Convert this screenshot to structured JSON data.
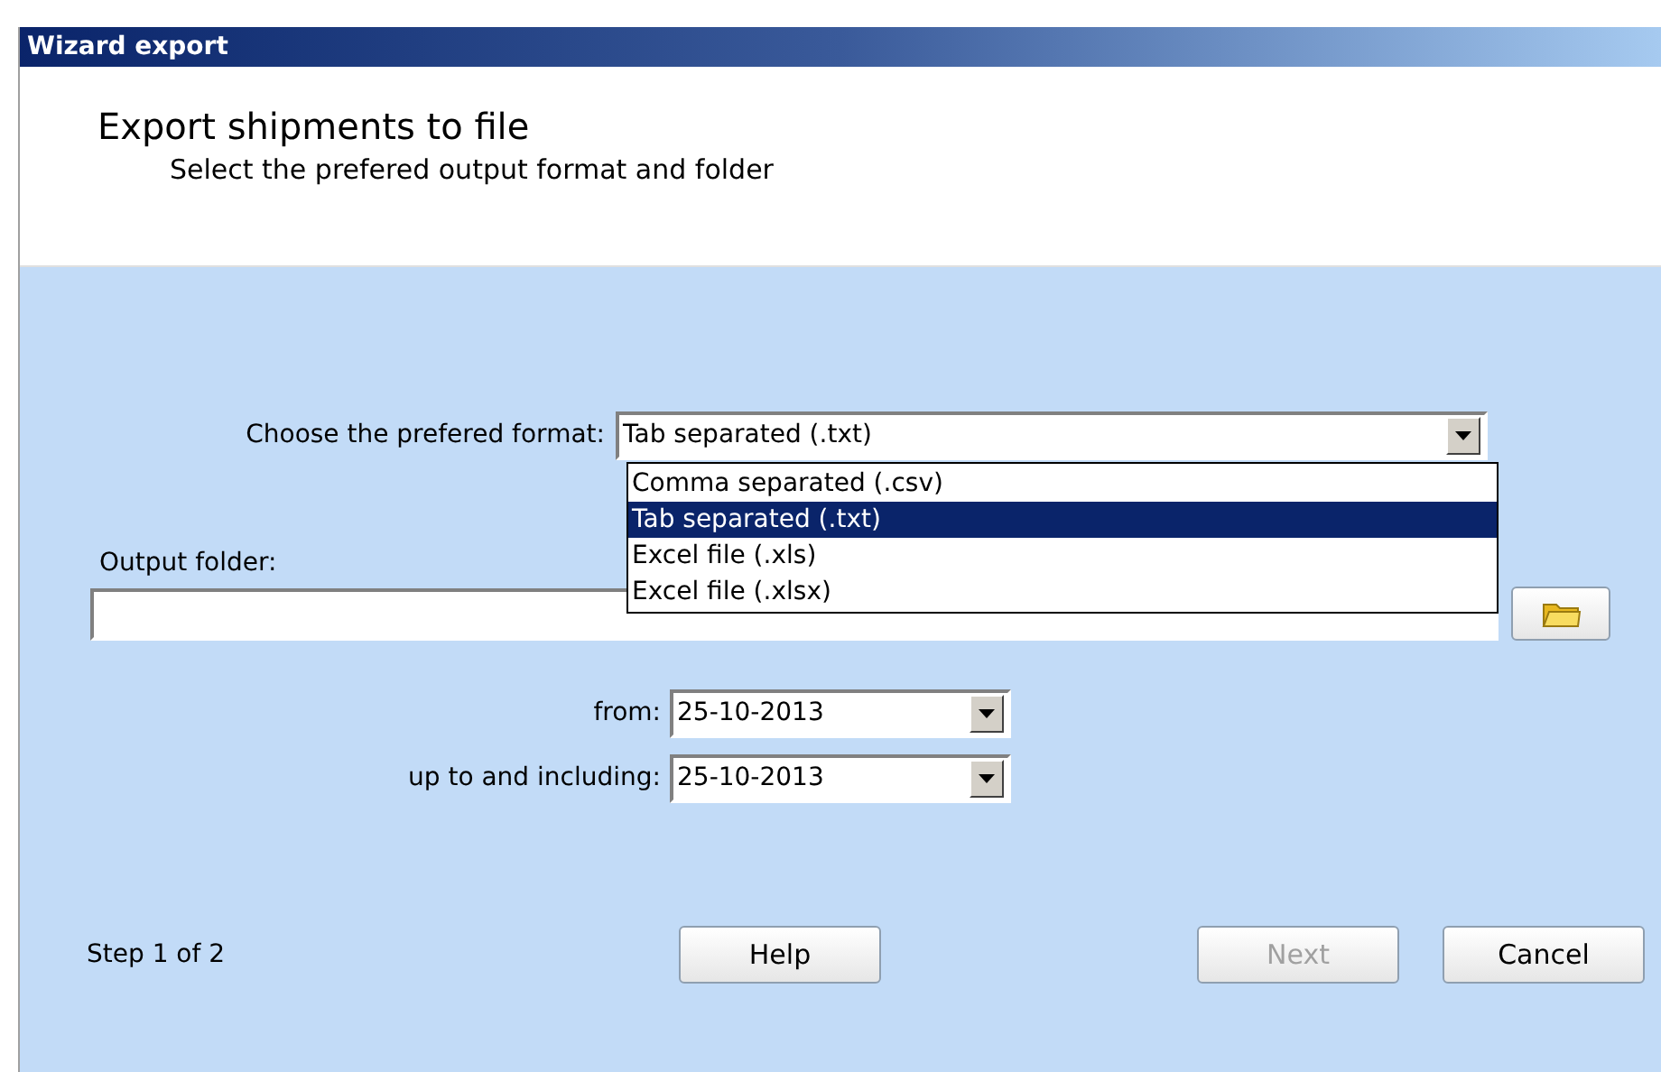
{
  "window": {
    "title": "Wizard export"
  },
  "header": {
    "title": "Export shipments to file",
    "subtitle": "Select the prefered output format and folder"
  },
  "format": {
    "label": "Choose the prefered format:",
    "value": "Tab separated (.txt)",
    "expanded": true,
    "options": [
      {
        "label": "Comma separated (.csv)",
        "selected": false
      },
      {
        "label": "Tab separated (.txt)",
        "selected": true
      },
      {
        "label": "Excel file (.xls)",
        "selected": false
      },
      {
        "label": "Excel file (.xlsx)",
        "selected": false
      }
    ]
  },
  "output_folder": {
    "label": "Output folder:"
  },
  "dates": [
    {
      "label": "from:",
      "value": "25-10-2013"
    },
    {
      "label": "up to and including:",
      "value": "25-10-2013"
    }
  ],
  "step": "Step 1 of 2",
  "buttons": [
    {
      "label": "Help",
      "disabled": false
    },
    {
      "label": "Next",
      "disabled": true
    },
    {
      "label": "Cancel",
      "disabled": false
    }
  ]
}
